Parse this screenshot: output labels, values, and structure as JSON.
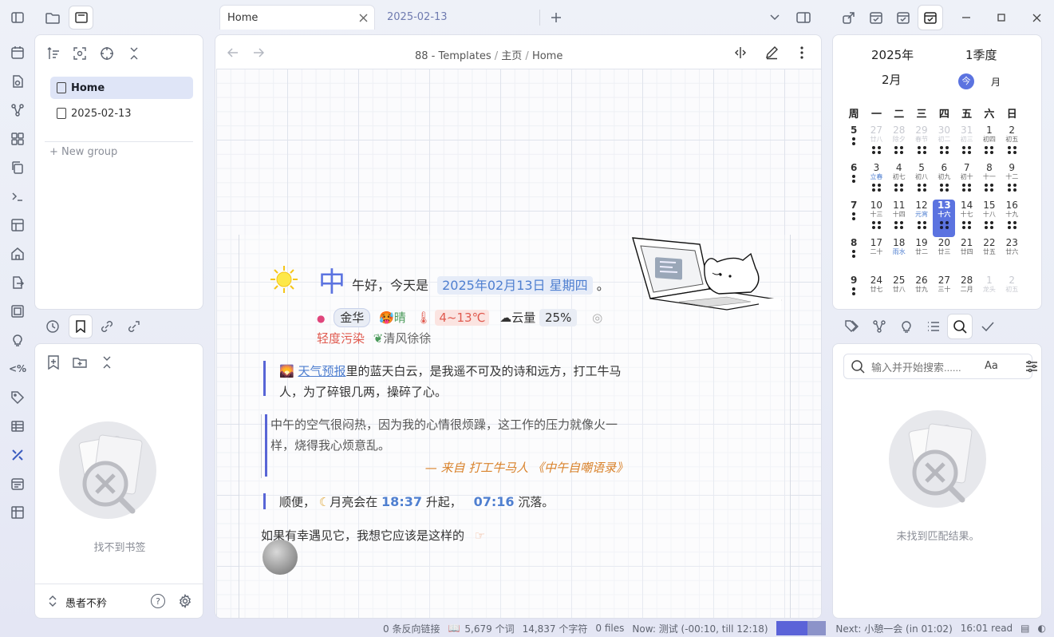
{
  "tabs": [
    {
      "label": "Home",
      "active": true
    },
    {
      "label": "2025-02-13",
      "active": false
    }
  ],
  "breadcrumb": [
    "88 - Templates",
    "主页",
    "Home"
  ],
  "breadcrumb_sep": "/",
  "file_tree": {
    "items": [
      {
        "label": "Home",
        "selected": true
      },
      {
        "label": "2025-02-13",
        "selected": false
      }
    ],
    "new_group": "New group"
  },
  "bookmarks": {
    "empty_text": "找不到书签"
  },
  "vault": {
    "name": "愚者不矜",
    "help": "?"
  },
  "note": {
    "greeting_big": "中",
    "greeting_rest": "午好，今天是",
    "date": "2025年02月13日 星期四",
    "period": "。",
    "city": "金华",
    "weather": "晴",
    "temp": "4~13℃",
    "cloud_label": "云量",
    "cloud_value": "25%",
    "pollution": "轻度污染",
    "wind": "清风徐徐",
    "forecast_link": "天气预报",
    "forecast_text": "里的蓝天白云，是我遥不可及的诗和远方，打工牛马人，为了碎银几两，操碎了心。",
    "quote_text": "中午的空气很闷热，因为我的心情很烦躁，这工作的压力就像火一样，烧得我心烦意乱。",
    "quote_source": "— 来自 打工牛马人 《中午自嘲语录》",
    "moon_prefix": "顺便，",
    "moon_text": "月亮会在",
    "moonrise": "18:37",
    "rise_word": "升起，",
    "moonset": "07:16",
    "set_word": "沉落。",
    "lucky_text": "如果有幸遇见它，我想它应该是这样的"
  },
  "calendar": {
    "year": "2025年",
    "quarter": "1季度",
    "month": "2月",
    "today_btn": "今",
    "view_btn": "月",
    "weekdays": [
      "周",
      "一",
      "二",
      "三",
      "四",
      "五",
      "六",
      "日"
    ],
    "rows": [
      {
        "week": "5",
        "days": [
          {
            "n": "27",
            "l": "廿八",
            "dim": true
          },
          {
            "n": "28",
            "l": "除夕",
            "dim": true
          },
          {
            "n": "29",
            "l": "春节",
            "dim": true
          },
          {
            "n": "30",
            "l": "初二",
            "dim": true
          },
          {
            "n": "31",
            "l": "初三",
            "dim": true
          },
          {
            "n": "1",
            "l": "初四"
          },
          {
            "n": "2",
            "l": "初五"
          }
        ]
      },
      {
        "week": "6",
        "days": [
          {
            "n": "3",
            "l": "立春",
            "blue": true
          },
          {
            "n": "4",
            "l": "初七"
          },
          {
            "n": "5",
            "l": "初八"
          },
          {
            "n": "6",
            "l": "初九"
          },
          {
            "n": "7",
            "l": "初十"
          },
          {
            "n": "8",
            "l": "十一"
          },
          {
            "n": "9",
            "l": "十二"
          }
        ]
      },
      {
        "week": "7",
        "days": [
          {
            "n": "10",
            "l": "十三"
          },
          {
            "n": "11",
            "l": "十四"
          },
          {
            "n": "12",
            "l": "元宵",
            "blue": true
          },
          {
            "n": "13",
            "l": "十六",
            "today": true
          },
          {
            "n": "14",
            "l": "十七"
          },
          {
            "n": "15",
            "l": "十八"
          },
          {
            "n": "16",
            "l": "十九"
          }
        ]
      },
      {
        "week": "8",
        "days": [
          {
            "n": "17",
            "l": "二十"
          },
          {
            "n": "18",
            "l": "雨水",
            "blue": true
          },
          {
            "n": "19",
            "l": "廿二"
          },
          {
            "n": "20",
            "l": "廿三"
          },
          {
            "n": "21",
            "l": "廿四"
          },
          {
            "n": "22",
            "l": "廿五"
          },
          {
            "n": "23",
            "l": "廿六"
          }
        ]
      },
      {
        "week": "9",
        "days": [
          {
            "n": "24",
            "l": "廿七"
          },
          {
            "n": "25",
            "l": "廿八"
          },
          {
            "n": "26",
            "l": "廿九"
          },
          {
            "n": "27",
            "l": "三十"
          },
          {
            "n": "28",
            "l": "二月"
          },
          {
            "n": "1",
            "l": "龙头",
            "dim": true
          },
          {
            "n": "2",
            "l": "初五",
            "dim": true
          }
        ]
      }
    ]
  },
  "search": {
    "placeholder": "输入并开始搜索......",
    "match_case": "Aa",
    "empty_text": "未找到匹配结果。"
  },
  "status_bar": {
    "backlinks": "0 条反向链接",
    "words": "5,679 个词",
    "chars": "14,837 个字符",
    "files": "0 files",
    "now": "Now: 测试 (-00:10, till 12:18)",
    "progress_fraction": 0.62,
    "next": "Next: 小憩一会 (in 01:02)",
    "read": "16:01 read"
  },
  "colors": {
    "accent": "#5b73e0",
    "date_blue": "#4f7fd0",
    "temp_red": "#e05a4f",
    "pollution_red": "#e05a4f",
    "wind_green": "#4a9a5a",
    "quote_orange": "#d9822b",
    "moon_time_blue": "#4f7fd0"
  }
}
